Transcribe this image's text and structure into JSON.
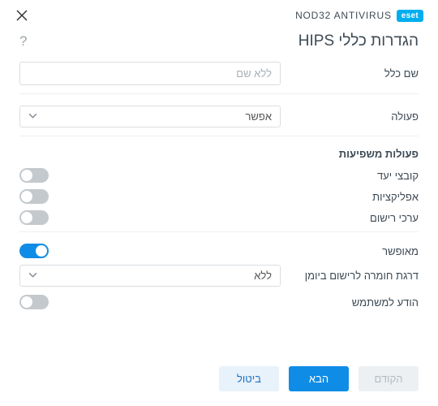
{
  "brand": {
    "badge": "eset",
    "product": "NOD32 ANTIVIRUS"
  },
  "title": "הגדרות כללי HIPS",
  "help_symbol": "?",
  "fields": {
    "rule_name_label": "שם כלל",
    "rule_name_placeholder": "ללא שם",
    "action_label": "פעולה",
    "action_value": "אפשר"
  },
  "sections": {
    "affecting_ops_title": "פעולות משפיעות",
    "target_files_label": "קובצי יעד",
    "applications_label": "אפליקציות",
    "registry_values_label": "ערכי רישום",
    "enabled_label": "מאופשר",
    "severity_label": "דרגת חומרה לרישום ביומן",
    "severity_value": "ללא",
    "notify_user_label": "הודע למשתמש"
  },
  "toggles": {
    "target_files": false,
    "applications": false,
    "registry_values": false,
    "enabled": true,
    "notify_user": false
  },
  "buttons": {
    "cancel": "ביטול",
    "next": "הבא",
    "previous": "הקודם"
  }
}
